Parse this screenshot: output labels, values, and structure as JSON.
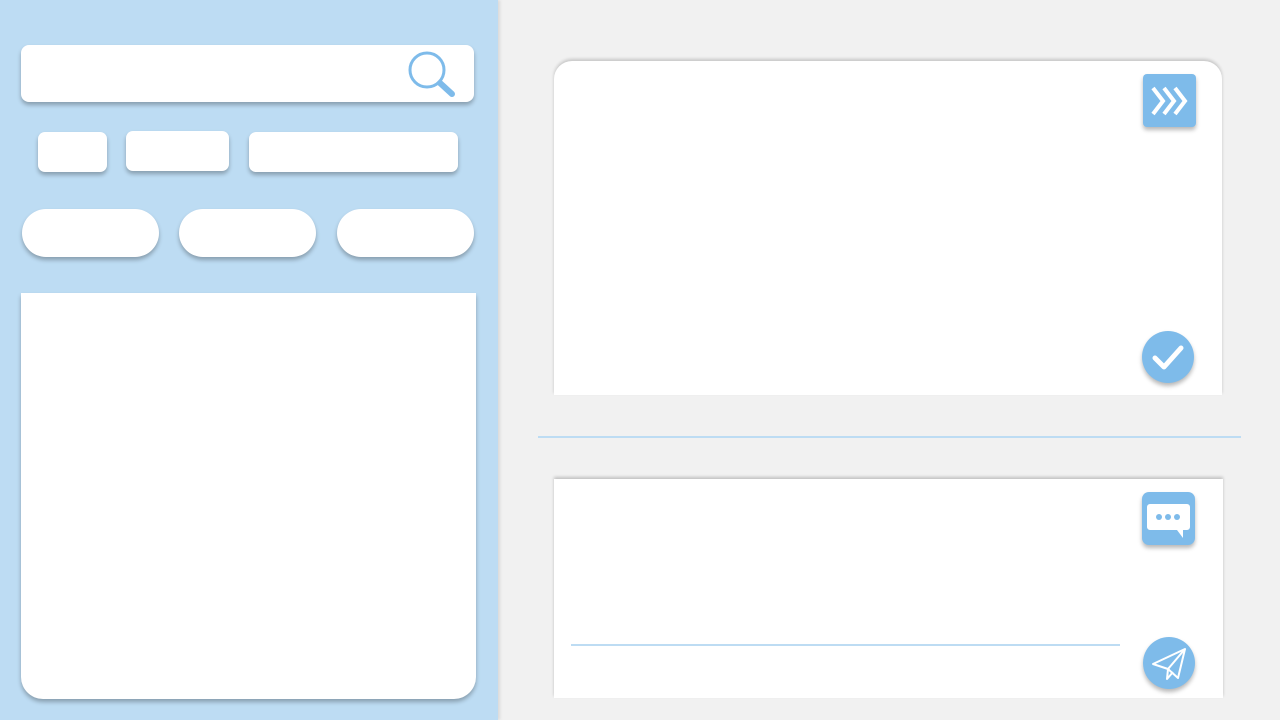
{
  "search": {
    "placeholder": "",
    "value": "",
    "icon": "search-icon"
  },
  "filters": {
    "chips": [
      {
        "label": ""
      },
      {
        "label": ""
      },
      {
        "label": ""
      }
    ],
    "pills": [
      {
        "label": ""
      },
      {
        "label": ""
      },
      {
        "label": ""
      }
    ]
  },
  "list": {
    "items": []
  },
  "top_card": {
    "forward_icon": "fast-forward-icon",
    "confirm_icon": "checkmark-icon"
  },
  "bottom_card": {
    "message_placeholder": "",
    "chat_icon": "chat-bubble-icon",
    "send_icon": "paper-plane-icon"
  },
  "colors": {
    "sidebar_bg": "#bddcf3",
    "accent": "#7ebbea",
    "page_bg": "#f1f1f1",
    "card_bg": "#ffffff"
  }
}
